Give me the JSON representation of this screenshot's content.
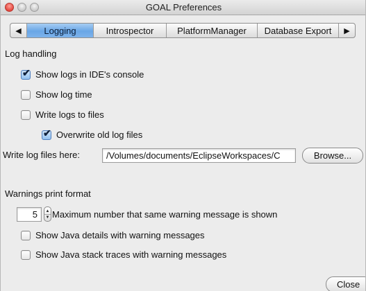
{
  "window": {
    "title": "GOAL Preferences"
  },
  "tabs": [
    {
      "label": "Logging",
      "selected": true
    },
    {
      "label": "Introspector",
      "selected": false
    },
    {
      "label": "PlatformManager",
      "selected": false
    },
    {
      "label": "Database Export",
      "selected": false
    }
  ],
  "tab_arrows": {
    "left": "◀",
    "right": "▶"
  },
  "log": {
    "section_title": "Log handling",
    "show_in_console": {
      "label": "Show logs in IDE's console",
      "checked": true
    },
    "show_time": {
      "label": "Show log time",
      "checked": false
    },
    "write_files": {
      "label": "Write logs to files",
      "checked": false
    },
    "overwrite": {
      "label": "Overwrite old log files",
      "checked": true
    },
    "path_label": "Write log files here:",
    "path_value": "/Volumes/documents/EclipseWorkspaces/C",
    "browse_label": "Browse..."
  },
  "warnings": {
    "section_title": "Warnings print format",
    "max_count": "5",
    "max_label": "Maximum number that same warning message is shown",
    "java_details": {
      "label": "Show Java details with warning messages",
      "checked": false
    },
    "java_stack": {
      "label": "Show Java stack traces with warning messages",
      "checked": false
    }
  },
  "footer": {
    "close_label": "Close"
  },
  "icons": {
    "checkmark": "✔",
    "stepper_up": "▲",
    "stepper_down": "▼"
  },
  "colors": {
    "selected_tab": "#6aa6e6",
    "window_bg": "#ececec"
  }
}
